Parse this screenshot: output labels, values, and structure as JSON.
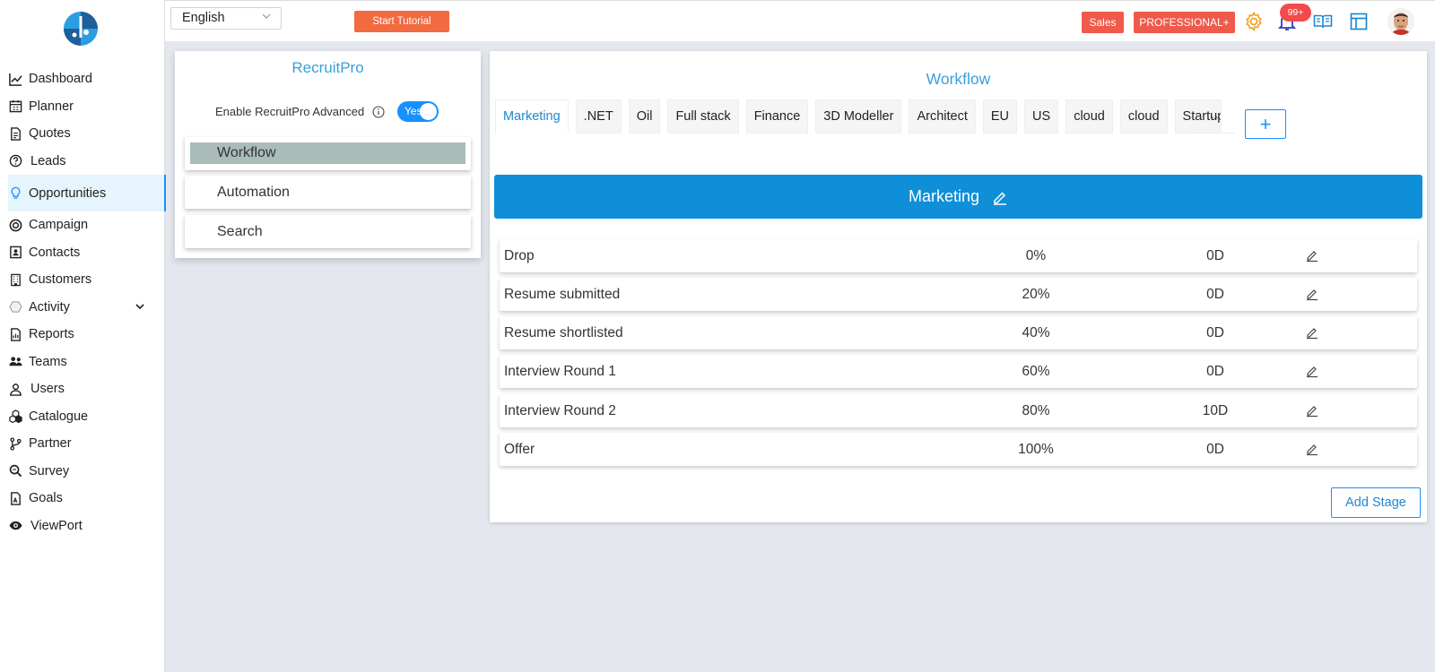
{
  "sidebar": {
    "items": [
      {
        "label": "Dashboard",
        "icon": "line-chart-icon"
      },
      {
        "label": "Planner",
        "icon": "calendar-icon"
      },
      {
        "label": "Quotes",
        "icon": "document-icon"
      },
      {
        "label": "Leads",
        "icon": "question-circle-icon"
      },
      {
        "label": "Opportunities",
        "icon": "lightbulb-icon"
      },
      {
        "label": "Campaign",
        "icon": "target-icon"
      },
      {
        "label": "Contacts",
        "icon": "contact-card-icon"
      },
      {
        "label": "Customers",
        "icon": "building-icon"
      },
      {
        "label": "Activity",
        "icon": "hexagon-icon"
      },
      {
        "label": "Reports",
        "icon": "report-icon"
      },
      {
        "label": "Teams",
        "icon": "team-icon"
      },
      {
        "label": "Users",
        "icon": "user-icon"
      },
      {
        "label": "Catalogue",
        "icon": "cubes-icon"
      },
      {
        "label": "Partner",
        "icon": "branch-icon"
      },
      {
        "label": "Survey",
        "icon": "search-doc-icon"
      },
      {
        "label": "Goals",
        "icon": "goal-doc-icon"
      },
      {
        "label": "ViewPort",
        "icon": "eye-icon"
      }
    ],
    "active_index": 4
  },
  "topbar": {
    "language": "English",
    "tutorial_label": "Start Tutorial",
    "sales_label": "Sales",
    "plan_label": "PROFESSIONAL+",
    "notification_count": "99+"
  },
  "recruitpro": {
    "title": "RecruitPro",
    "enable_label": "Enable RecruitPro Advanced",
    "toggle_label": "Yes",
    "menu": [
      "Workflow",
      "Automation",
      "Search"
    ]
  },
  "workflow": {
    "title": "Workflow",
    "tabs": [
      "Marketing",
      ".NET",
      "Oil",
      "Full stack",
      "Finance",
      "3D Modeller",
      "Architect",
      "EU",
      "US",
      "cloud",
      "cloud",
      "Startup"
    ],
    "more_label": "···",
    "add_label": "+",
    "header": "Marketing",
    "stages": [
      {
        "name": "Drop",
        "percent": "0%",
        "days": "0D"
      },
      {
        "name": "Resume submitted",
        "percent": "20%",
        "days": "0D"
      },
      {
        "name": "Resume shortlisted",
        "percent": "40%",
        "days": "0D"
      },
      {
        "name": "Interview Round 1",
        "percent": "60%",
        "days": "0D"
      },
      {
        "name": "Interview Round 2",
        "percent": "80%",
        "days": "10D"
      },
      {
        "name": "Offer",
        "percent": "100%",
        "days": "0D"
      }
    ],
    "add_stage_label": "Add Stage"
  },
  "colors": {
    "accent": "#1890ff",
    "header_blue": "#0e8fd8",
    "title_blue": "#3b9fd9",
    "orange": "#f26a3f",
    "red_badge": "#ef5a4a",
    "selected_menu": "#a9bcb9"
  }
}
